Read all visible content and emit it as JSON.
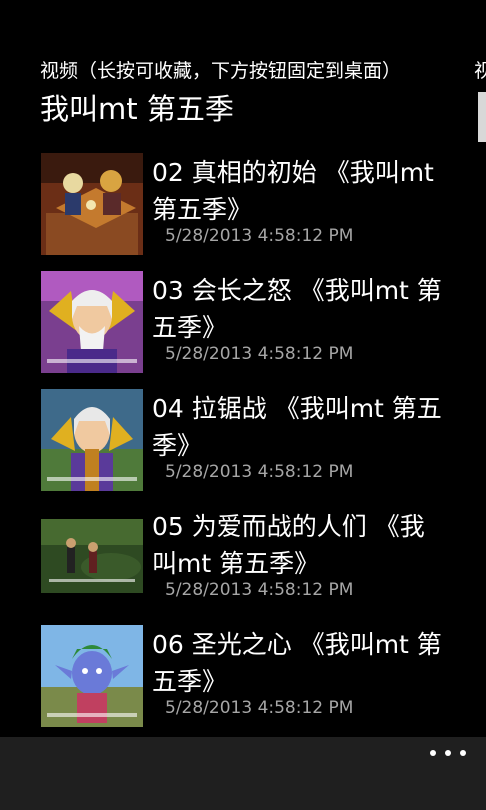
{
  "header": {
    "pivot_label": "视频（长按可收藏，下方按钮固定到桌面）",
    "pivot_peek_label": "视",
    "page_title": "我叫mt 第五季"
  },
  "episodes": [
    {
      "title": "02 真相的初始 《我叫mt 第五季》",
      "date": "5/28/2013 4:58:12 PM"
    },
    {
      "title": "03 会长之怒 《我叫mt 第五季》",
      "date": "5/28/2013 4:58:12 PM"
    },
    {
      "title": "04 拉锯战 《我叫mt 第五季》",
      "date": "5/28/2013 4:58:12 PM"
    },
    {
      "title": "05 为爱而战的人们 《我叫mt 第五季》",
      "date": "5/28/2013 4:58:12 PM"
    },
    {
      "title": "06 圣光之心 《我叫mt 第五季》",
      "date": "5/28/2013 4:58:12 PM"
    }
  ],
  "appbar": {
    "more_icon": "ellipsis-icon"
  },
  "colors": {
    "background": "#000000",
    "appbar": "#1f1f1f",
    "secondary_text": "#a6a6a6"
  }
}
